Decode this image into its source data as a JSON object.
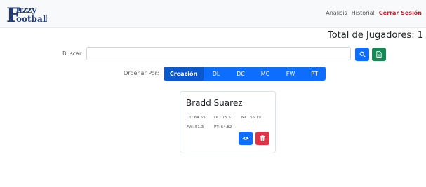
{
  "brand": {
    "line1": "Fuzzy",
    "line2": "Football"
  },
  "nav": {
    "analysis": "Análisis",
    "history": "Historial",
    "logout": "Cerrar Sesión"
  },
  "summary": {
    "total_label": "Total de Jugadores: 1"
  },
  "search": {
    "label": "Buscar:",
    "value": "",
    "placeholder": ""
  },
  "order": {
    "label": "Ordenar Por:",
    "options": [
      "Creación",
      "DL",
      "DC",
      "MC",
      "FW",
      "PT"
    ],
    "selected": "Creación"
  },
  "players": [
    {
      "name": "Bradd Suarez",
      "stats": {
        "dl": "DL: 64.55",
        "dc": "DC: 75.51",
        "mc": "MC: 55.19",
        "fw": "FW: 51.3",
        "pt": "PT: 64.82"
      }
    }
  ],
  "colors": {
    "primary": "#0d6efd",
    "primary_active": "#0a58ca",
    "success": "#198754",
    "danger": "#dc3545",
    "logout": "#c0202e",
    "brand": "#1f3b7a"
  },
  "icons": {
    "search": "search-icon",
    "report": "file-icon",
    "view": "eye-icon",
    "delete": "trash-icon"
  }
}
